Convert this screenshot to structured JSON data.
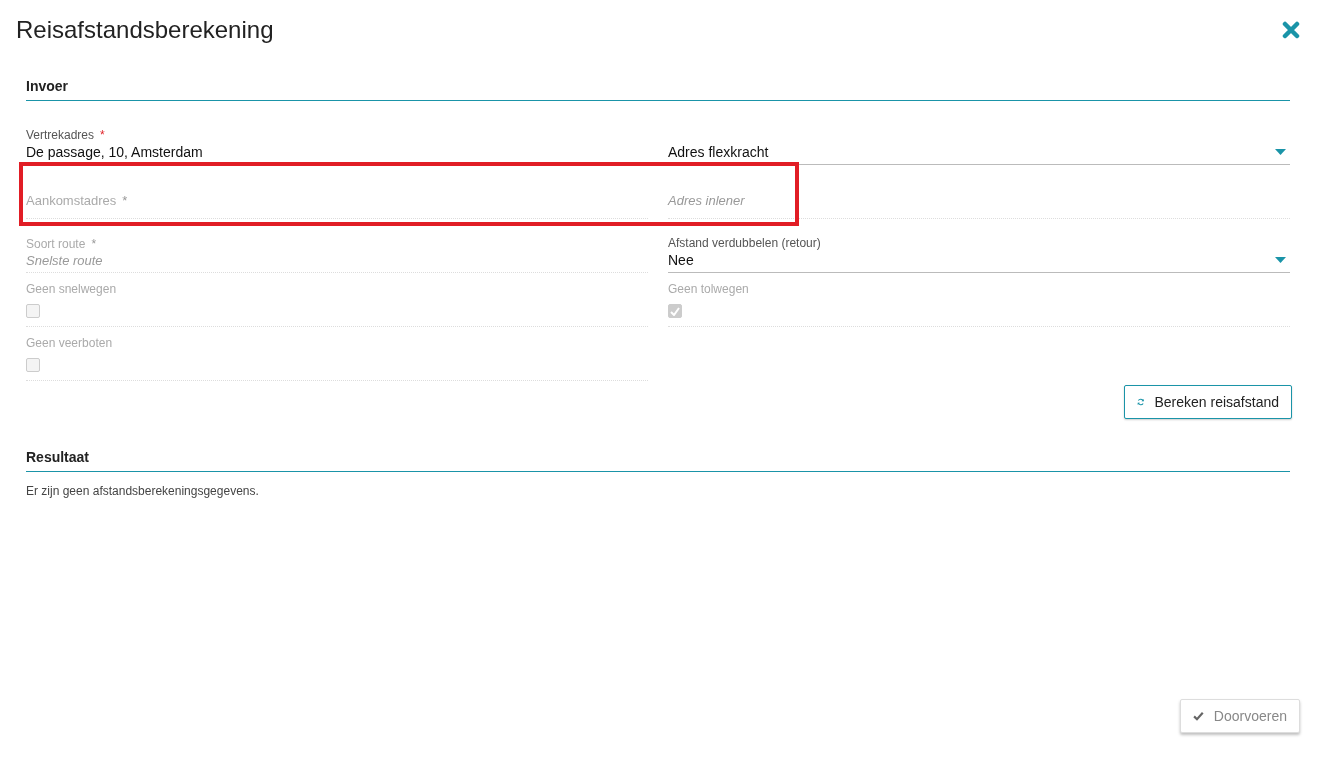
{
  "dialog": {
    "title": "Reisafstandsberekening"
  },
  "input_section": {
    "title": "Invoer",
    "rows": [
      [
        {
          "kind": "text",
          "label": "Vertrekadres",
          "required_mark": "*",
          "value": "De passage, 10, Amsterdam",
          "disabled": false
        },
        {
          "kind": "select",
          "value": "Adres flexkracht",
          "disabled": false
        }
      ],
      [
        {
          "kind": "text",
          "placeholder": "Aankomstadres",
          "required_mark": "*",
          "disabled": true,
          "highlighted": true
        },
        {
          "kind": "text",
          "placeholder": "Adres inlener",
          "disabled": true
        }
      ],
      [
        {
          "kind": "text",
          "label": "Soort route",
          "required_mark": "*",
          "placeholder": "Snelste route",
          "disabled": true
        },
        {
          "kind": "select",
          "label": "Afstand verdubbelen (retour)",
          "value": "Nee",
          "disabled": false
        }
      ],
      [
        {
          "kind": "checkbox",
          "label": "Geen snelwegen",
          "checked": false,
          "disabled": true
        },
        {
          "kind": "checkbox",
          "label": "Geen tolwegen",
          "checked": true,
          "disabled": true
        }
      ],
      [
        {
          "kind": "checkbox",
          "label": "Geen veerboten",
          "checked": false,
          "disabled": true
        }
      ]
    ],
    "button": {
      "label": "Bereken reisafstand",
      "disabled": false
    }
  },
  "result_section": {
    "title": "Resultaat",
    "message": "Er zijn geen afstandsberekeningsgegevens."
  },
  "footer": {
    "button": {
      "label": "Doorvoeren",
      "disabled": true
    }
  }
}
